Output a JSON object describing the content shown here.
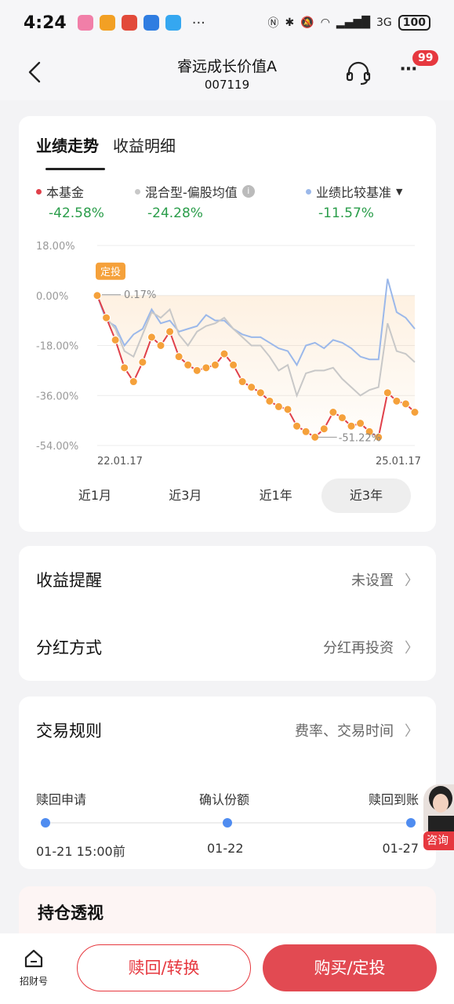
{
  "status_bar": {
    "time": "4:24",
    "more": "···",
    "network": "3G",
    "battery": "100"
  },
  "header": {
    "title": "睿远成长价值A",
    "code": "007119",
    "badge": "99"
  },
  "tabs": [
    {
      "label": "业绩走势",
      "active": true
    },
    {
      "label": "收益明细",
      "active": false
    }
  ],
  "legend": [
    {
      "name": "本基金",
      "value": "-42.58%",
      "color": "#e0404a"
    },
    {
      "name": "混合型-偏股均值",
      "value": "-24.28%",
      "color": "#c8c8c8"
    },
    {
      "name": "业绩比较基准",
      "value": "-11.57%",
      "color": "#9bb8ea"
    }
  ],
  "chart_data": {
    "type": "line",
    "y_ticks": [
      "18.00%",
      "0.00%",
      "-18.00%",
      "-36.00%",
      "-54.00%"
    ],
    "ylim": [
      -54,
      18
    ],
    "x_labels": [
      "22.01.17",
      "25.01.17"
    ],
    "start_tag": "定投",
    "annotations": {
      "max_label": "0.17%",
      "min_label": "-51.22%"
    },
    "series": [
      {
        "name": "本基金",
        "color": "#e0404a",
        "values": [
          0,
          -8,
          -16,
          -26,
          -31,
          -24,
          -15,
          -18,
          -13,
          -22,
          -25,
          -27,
          -26,
          -25,
          -21,
          -25,
          -31,
          -33,
          -35,
          -38,
          -40,
          -41,
          -47,
          -49,
          -51,
          -48,
          -42,
          -44,
          -47,
          -46,
          -49,
          -51,
          -35,
          -38,
          -39,
          -42
        ]
      },
      {
        "name": "混合型-偏股均值",
        "color": "#c8c8c8",
        "values": [
          0,
          -8,
          -12,
          -20,
          -22,
          -14,
          -6,
          -8,
          -5,
          -14,
          -18,
          -13,
          -11,
          -10,
          -8,
          -12,
          -15,
          -18,
          -18,
          -22,
          -27,
          -25,
          -36,
          -28,
          -27,
          -27,
          -26,
          -30,
          -33,
          -36,
          -34,
          -33,
          -10,
          -20,
          -21,
          -24
        ]
      },
      {
        "name": "业绩比较基准",
        "color": "#9bb8ea",
        "values": [
          0,
          -9,
          -11,
          -18,
          -14,
          -12,
          -5,
          -10,
          -9,
          -13,
          -12,
          -11,
          -7,
          -9,
          -9,
          -12,
          -14,
          -15,
          -15,
          -17,
          -19,
          -20,
          -25,
          -18,
          -17,
          -19,
          -16,
          -17,
          -19,
          -22,
          -23,
          -23,
          6,
          -6,
          -8,
          -12
        ]
      }
    ],
    "dots_series": "本基金",
    "grid": true
  },
  "ranges": [
    {
      "label": "近1月",
      "active": false
    },
    {
      "label": "近3月",
      "active": false
    },
    {
      "label": "近1年",
      "active": false
    },
    {
      "label": "近3年",
      "active": true
    }
  ],
  "settings": {
    "reminder_label": "收益提醒",
    "reminder_value": "未设置",
    "dividend_label": "分红方式",
    "dividend_value": "分红再投资"
  },
  "rules": {
    "title": "交易规则",
    "value": "费率、交易时间",
    "steps": [
      {
        "label": "赎回申请",
        "date": "01-21 15:00前"
      },
      {
        "label": "确认份额",
        "date": "01-22"
      },
      {
        "label": "赎回到账",
        "date": "01-27"
      }
    ]
  },
  "consult_label": "咨询",
  "holdings_title": "持仓透视",
  "bottom_bar": {
    "home_label": "招财号",
    "redeem_label": "赎回/转换",
    "buy_label": "购买/定投"
  },
  "colors": {
    "accent": "#e6383f",
    "positive_negative_text": "#2a9d4a",
    "timeline_dot": "#4f8cf0",
    "dot_fill": "#f5a13b"
  }
}
